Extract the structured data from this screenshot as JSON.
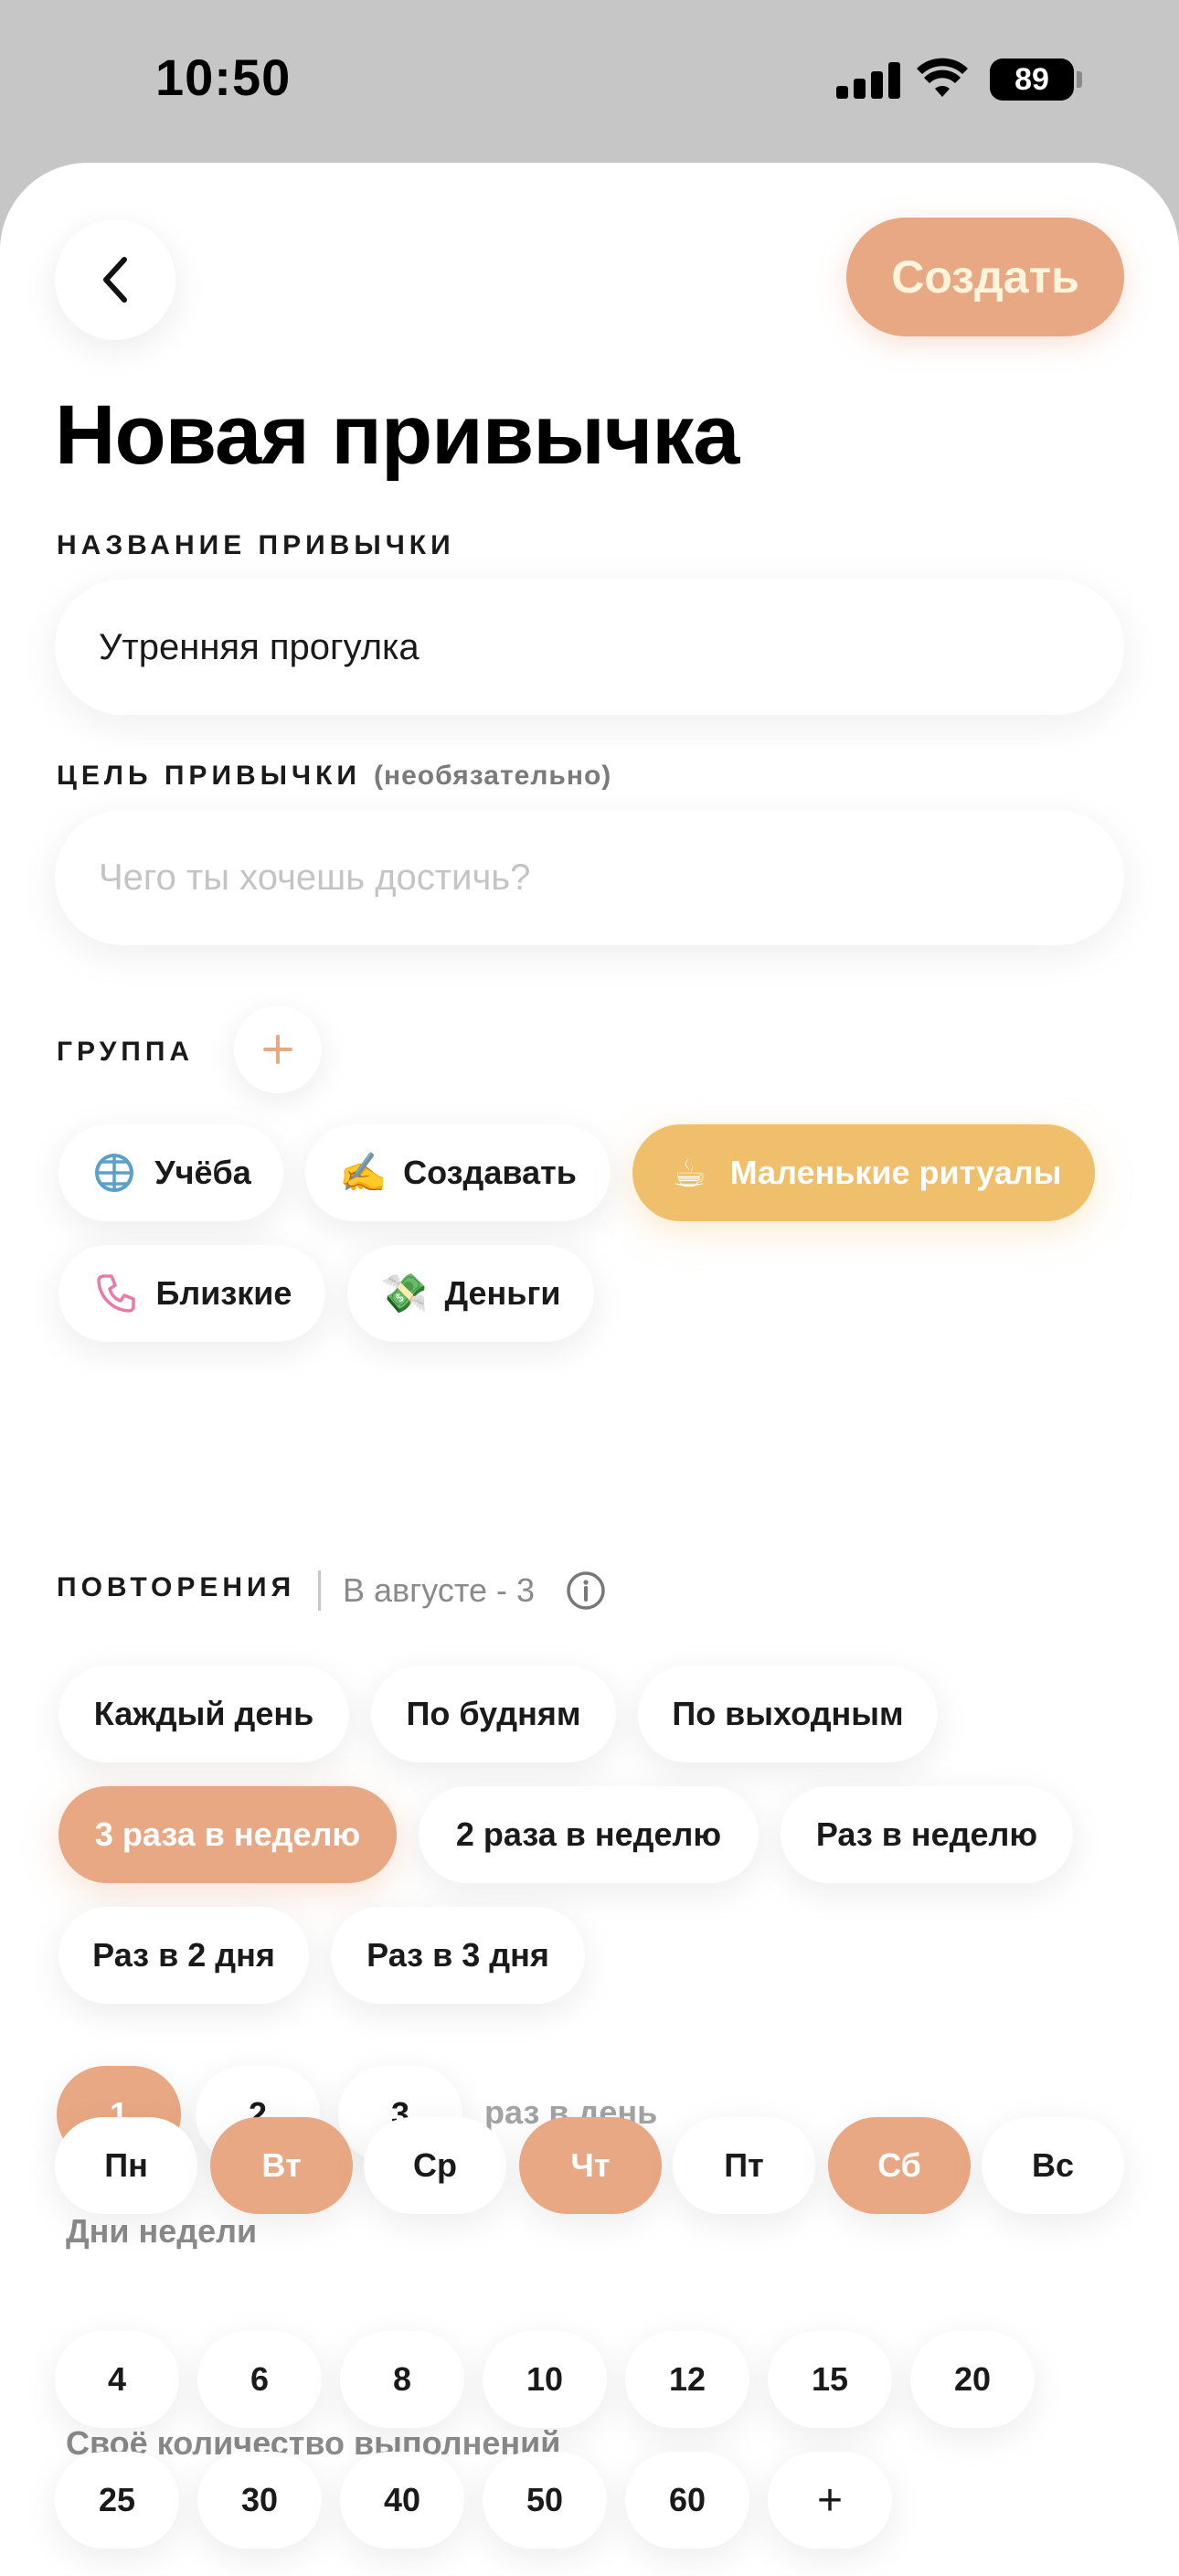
{
  "status_bar": {
    "time": "10:50",
    "battery": "89"
  },
  "header": {
    "create_label": "Создать",
    "title": "Новая привычка"
  },
  "name_section": {
    "label": "НАЗВАНИЕ ПРИВЫЧКИ",
    "value": "Утренняя прогулка"
  },
  "goal_section": {
    "label": "ЦЕЛЬ ПРИВЫЧКИ",
    "optional": "(необязательно)",
    "placeholder": "Чего ты хочешь достичь?"
  },
  "group_section": {
    "label": "ГРУППА",
    "groups": [
      {
        "label": "Учёба",
        "icon": "globe-grid-icon",
        "selected": false
      },
      {
        "label": "Создавать",
        "icon": "✍️",
        "selected": false
      },
      {
        "label": "Маленькие ритуалы",
        "icon": "☕",
        "selected": true
      },
      {
        "label": "Близкие",
        "icon": "phone-icon",
        "selected": false
      },
      {
        "label": "Деньги",
        "icon": "💸",
        "selected": false
      }
    ]
  },
  "repetitions": {
    "label": "ПОВТОРЕНИЯ",
    "month_info": "В августе - 3",
    "options": [
      {
        "label": "Каждый день",
        "selected": false
      },
      {
        "label": "По будням",
        "selected": false
      },
      {
        "label": "По выходным",
        "selected": false
      },
      {
        "label": "3 раза в неделю",
        "selected": true
      },
      {
        "label": "2 раза в неделю",
        "selected": false
      },
      {
        "label": "Раз в неделю",
        "selected": false
      },
      {
        "label": "Раз в 2 дня",
        "selected": false
      },
      {
        "label": "Раз в 3 дня",
        "selected": false
      }
    ],
    "times_per_day": [
      {
        "label": "1",
        "selected": true
      },
      {
        "label": "2",
        "selected": false
      },
      {
        "label": "3",
        "selected": false
      }
    ],
    "times_per_day_suffix": "раз в день",
    "weekdays_label": "Дни недели",
    "weekdays": [
      {
        "label": "Пн",
        "selected": false
      },
      {
        "label": "Вт",
        "selected": true
      },
      {
        "label": "Ср",
        "selected": false
      },
      {
        "label": "Чт",
        "selected": true
      },
      {
        "label": "Пт",
        "selected": false
      },
      {
        "label": "Сб",
        "selected": true
      },
      {
        "label": "Вс",
        "selected": false
      }
    ],
    "custom_label": "Своё количество выполнений",
    "custom_counts": [
      "4",
      "6",
      "8",
      "10",
      "12",
      "15",
      "20",
      "25",
      "30",
      "40",
      "50",
      "60"
    ],
    "custom_add": "+"
  },
  "colors": {
    "accent_peach": "#e8a883",
    "accent_yellow": "#f0bf6c",
    "create_text": "#fff4dc"
  }
}
